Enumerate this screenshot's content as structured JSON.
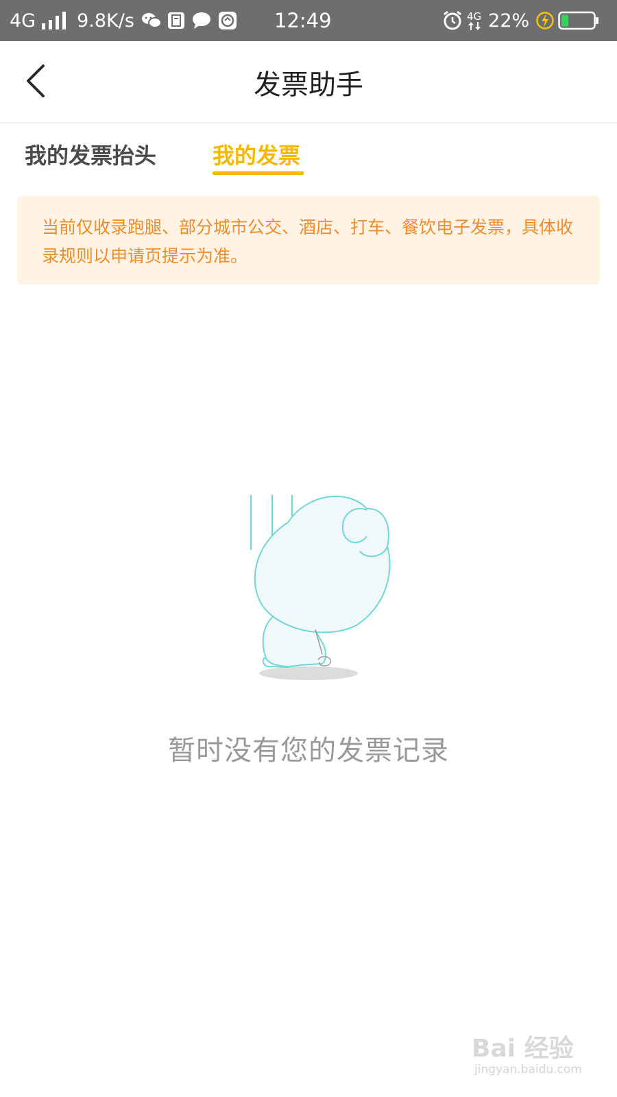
{
  "status_bar": {
    "network": "4G",
    "speed": "9.8K/s",
    "time": "12:49",
    "network_right": "4G",
    "battery_percent": "22%",
    "battery_level": 0.22,
    "icons": [
      "signal-icon",
      "wechat-icon",
      "app-icon",
      "chat-bubble-icon",
      "app-badge-icon",
      "alarm-icon",
      "data-arrows-icon",
      "charging-icon",
      "battery-icon"
    ]
  },
  "header": {
    "title": "发票助手",
    "back_icon": "chevron-left-icon"
  },
  "tabs": [
    {
      "label": "我的发票抬头",
      "active": false
    },
    {
      "label": "我的发票",
      "active": true
    }
  ],
  "notice": {
    "text": "当前仅收录跑腿、部分城市公交、酒店、打车、餐饮电子发票，具体收录规则以申请页提示为准。"
  },
  "empty_state": {
    "message": "暂时没有您的发票记录",
    "illustration": "sad-character-illustration"
  },
  "watermark": {
    "logo": "Bai 经验",
    "url": "jingyan.baidu.com"
  },
  "colors": {
    "accent": "#f5b800",
    "notice_bg": "#fff3e6",
    "notice_text": "#ef8c2a",
    "status_bar_bg": "#6e6e70",
    "illustration_stroke": "#6ed8d8"
  }
}
